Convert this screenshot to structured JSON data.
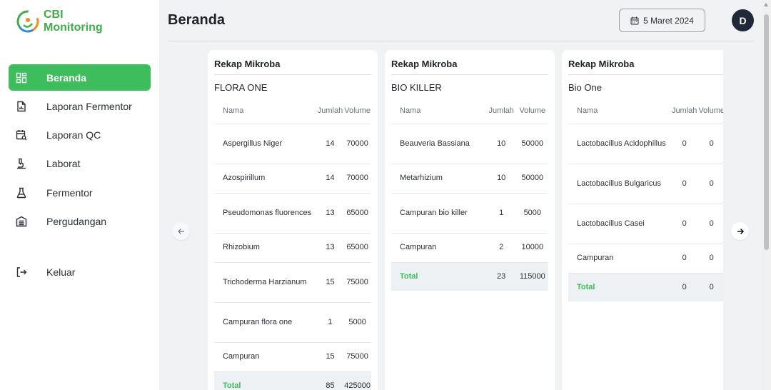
{
  "brand": {
    "line1": "CBI",
    "line2": "Monitoring"
  },
  "sidebar": {
    "items": [
      {
        "label": "Beranda",
        "icon": "dashboard-icon",
        "active": true
      },
      {
        "label": "Laporan Fermentor",
        "icon": "report-file-icon"
      },
      {
        "label": "Laporan QC",
        "icon": "calendar-search-icon"
      },
      {
        "label": "Laborat",
        "icon": "microscope-icon"
      },
      {
        "label": "Fermentor",
        "icon": "flask-icon"
      },
      {
        "label": "Pergudangan",
        "icon": "warehouse-icon"
      }
    ],
    "logout": {
      "label": "Keluar",
      "icon": "logout-icon"
    }
  },
  "header": {
    "title": "Beranda",
    "date": "5 Maret 2024",
    "avatar_initial": "D"
  },
  "columns": {
    "name": "Nama",
    "count": "Jumlah",
    "volume": "Volume"
  },
  "cards": [
    {
      "title": "Rekap Mikroba",
      "subtitle": "FLORA ONE",
      "rows": [
        {
          "name": "Aspergillus Niger",
          "count": "14",
          "volume": "70000"
        },
        {
          "name": "Azospirillum",
          "count": "14",
          "volume": "70000"
        },
        {
          "name": "Pseudomonas fluorences",
          "count": "13",
          "volume": "65000"
        },
        {
          "name": "Rhizobium",
          "count": "13",
          "volume": "65000"
        },
        {
          "name": "Trichoderma Harzianum",
          "count": "15",
          "volume": "75000"
        },
        {
          "name": "Campuran flora one",
          "count": "1",
          "volume": "5000"
        },
        {
          "name": "Campuran",
          "count": "15",
          "volume": "75000"
        }
      ],
      "total": {
        "label": "Total",
        "count": "85",
        "volume": "425000"
      }
    },
    {
      "title": "Rekap Mikroba",
      "subtitle": "BIO KILLER",
      "rows": [
        {
          "name": "Beauveria Bassiana",
          "count": "10",
          "volume": "50000"
        },
        {
          "name": "Metarhizium",
          "count": "10",
          "volume": "50000"
        },
        {
          "name": "Campuran bio killer",
          "count": "1",
          "volume": "5000"
        },
        {
          "name": "Campuran",
          "count": "2",
          "volume": "10000"
        }
      ],
      "total": {
        "label": "Total",
        "count": "23",
        "volume": "115000"
      }
    },
    {
      "title": "Rekap Mikroba",
      "subtitle": "Bio One",
      "rows": [
        {
          "name": "Lactobacillus Acidophillus",
          "count": "0",
          "volume": "0"
        },
        {
          "name": "Lactobacillus Bulgaricus",
          "count": "0",
          "volume": "0"
        },
        {
          "name": "Lactobacillus Casei",
          "count": "0",
          "volume": "0"
        },
        {
          "name": "Campuran",
          "count": "0",
          "volume": "0"
        }
      ],
      "total": {
        "label": "Total",
        "count": "0",
        "volume": "0"
      }
    }
  ],
  "colors": {
    "accent": "#3dbd5c",
    "avatar_bg": "#1f2937"
  }
}
